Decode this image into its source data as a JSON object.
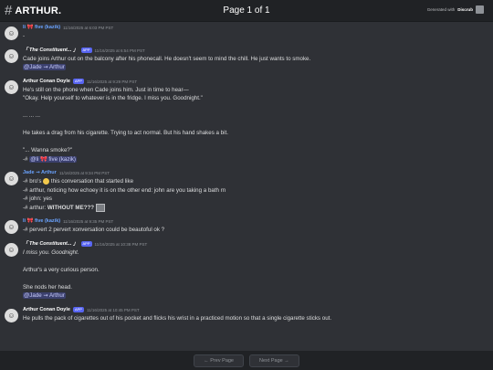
{
  "header": {
    "hash": "#",
    "channel": "ARTHUR.",
    "page": "Page 1 of 1",
    "generated_prefix": "Generated with",
    "generated_by": "Discrub"
  },
  "messages": [
    {
      "author": "li 🎀 five (kazik)",
      "author_style": "blue",
      "timestamp": "11/16/2025 at 6:03 PM PST",
      "lines": [
        {
          "text": "-"
        }
      ]
    },
    {
      "author": "「 The Constituent... 」",
      "author_style": "italic",
      "app": "APP",
      "timestamp": "11/16/2025 at 6:54 PM PST",
      "lines": [
        {
          "text": "Cade joins Arthur out on the balcony after his phonecall. He doesn't seem to mind the chill. He just wants to smoke."
        },
        {
          "mention": "@Jade ⇝ Arthur"
        }
      ]
    },
    {
      "author": "Arthur Conan Doyle",
      "author_style": "",
      "app": "APP",
      "timestamp": "11/16/2025 at 9:29 PM PST",
      "lines": [
        {
          "text": "He's still on the phone when Cade joins him. Just in time to hear—"
        },
        {
          "text": "\"Okay. Help yourself to whatever is in the fridge. I miss you. Goodnight.\""
        },
        {
          "gap": true
        },
        {
          "text": "... ... ..."
        },
        {
          "gap": true
        },
        {
          "text": "He takes a drag from his cigarette. Trying to act normal. But his hand shakes a bit."
        },
        {
          "gap": true
        },
        {
          "text": "\"... Wanna smoke?\""
        },
        {
          "prefix": "-# ",
          "mention": "@li 🎀 five (kazik)"
        }
      ]
    },
    {
      "author": "Jade ⇝ Arthur",
      "author_style": "blue",
      "timestamp": "11/16/2025 at 9:34 PM PST",
      "lines": [
        {
          "text": "-# bro's",
          "suffix": " this conversation that started like",
          "emoji": true
        },
        {
          "text": "-# arthur, noticing how echoey it is on the other end: john are you taking a bath rn"
        },
        {
          "text": "-# john: yes"
        },
        {
          "text": "-# arthur: ",
          "bold": "WITHOUT ME???",
          "thumb": true
        }
      ]
    },
    {
      "author": "li 🎀 five (kazik)",
      "author_style": "blue",
      "timestamp": "11/16/2025 at 9:35 PM PST",
      "lines": [
        {
          "text": "-# pervert 2 pervert xonversation could be beautoful ok ?"
        }
      ]
    },
    {
      "author": "「 The Constituent... 」",
      "author_style": "italic",
      "app": "APP",
      "timestamp": "11/16/2025 at 10:38 PM PST",
      "lines": [
        {
          "text": "I miss you. Goodnight.",
          "em": true
        },
        {
          "gap": true
        },
        {
          "text": "Arthur's a very curious person."
        },
        {
          "gap": true
        },
        {
          "text": "She nods her head."
        },
        {
          "mention": "@Jade ⇝ Arthur"
        }
      ]
    },
    {
      "author": "Arthur Conan Doyle",
      "author_style": "",
      "app": "APP",
      "timestamp": "11/16/2025 at 10:45 PM PST",
      "lines": [
        {
          "text": "He pulls the pack of cigarettes out of his pocket and flicks his wrist in a practiced motion so that a single cigarette sticks out."
        }
      ]
    }
  ],
  "footer": {
    "prev": "← Prev Page",
    "next": "Next Page →"
  }
}
